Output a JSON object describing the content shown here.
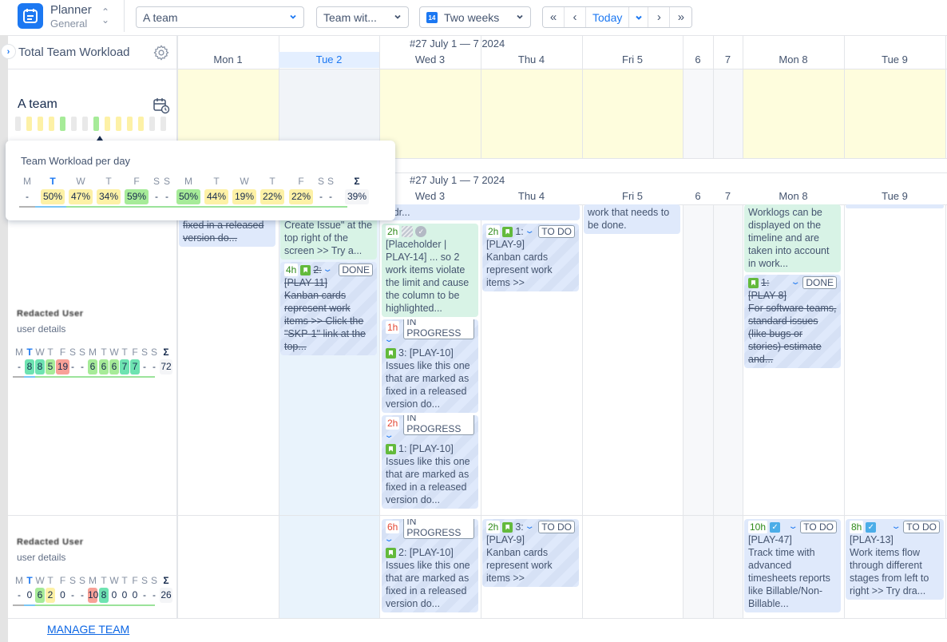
{
  "app": {
    "name": "Planner",
    "subtitle": "General"
  },
  "toolbar": {
    "team_select": "A team",
    "team_with_select": "Team wit...",
    "range_icon_day": "14",
    "range_select": "Two weeks",
    "nav_first": "«",
    "nav_prev": "‹",
    "today": "Today",
    "nav_next": "›",
    "nav_last": "»"
  },
  "panel": {
    "title": "Total Team Workload",
    "manage_team": "MANAGE TEAM"
  },
  "calendar": {
    "week_label": "#27 July 1 — 7 2024",
    "days": [
      "Mon 1",
      "Tue 2",
      "Wed 3",
      "Thu 4",
      "Fri 5",
      "6",
      "7",
      "Mon 8",
      "Tue 9"
    ],
    "today_index": 1
  },
  "team": {
    "name": "A team",
    "minibar_levels": [
      "none",
      "low",
      "low",
      "low",
      "mid",
      "none",
      "none",
      "mid",
      "low",
      "low",
      "low",
      "low",
      "none",
      "none"
    ]
  },
  "tooltip": {
    "title": "Team Workload per day",
    "headers": [
      "M",
      "T",
      "W",
      "T",
      "F",
      "S",
      "S",
      "M",
      "T",
      "W",
      "T",
      "F",
      "S",
      "S",
      "Σ"
    ],
    "values": [
      "-",
      "50%",
      "47%",
      "34%",
      "59%",
      "-",
      "-",
      "50%",
      "44%",
      "19%",
      "22%",
      "22%",
      "-",
      "-",
      "39%"
    ],
    "levels": [
      "none",
      "low",
      "low",
      "low",
      "mid",
      "none",
      "none",
      "mid",
      "low",
      "low",
      "low",
      "low",
      "none",
      "none",
      "sum"
    ]
  },
  "users": [
    {
      "name": "Redacted User",
      "details_label": "user details",
      "headers": [
        "M",
        "T",
        "W",
        "T",
        "F",
        "S",
        "S",
        "M",
        "T",
        "W",
        "T",
        "F",
        "S",
        "S",
        "Σ"
      ],
      "values": [
        "-",
        "8",
        "8",
        "5",
        "19",
        "-",
        "-",
        "6",
        "6",
        "6",
        "7",
        "7",
        "-",
        "-",
        "72"
      ],
      "levels": [
        "none",
        "ok",
        "ok",
        "mid",
        "over",
        "none",
        "none",
        "mid",
        "mid",
        "mid",
        "ok",
        "ok",
        "none",
        "none",
        "sum"
      ]
    },
    {
      "name": "Redacted User",
      "details_label": "user details",
      "headers": [
        "M",
        "T",
        "W",
        "T",
        "F",
        "S",
        "S",
        "M",
        "T",
        "W",
        "T",
        "F",
        "S",
        "S",
        "Σ"
      ],
      "values": [
        "-",
        "0",
        "6",
        "2",
        "0",
        "-",
        "-",
        "10",
        "8",
        "0",
        "0",
        "0",
        "-",
        "-",
        "26"
      ],
      "levels": [
        "none",
        "none",
        "mid",
        "low",
        "none",
        "none",
        "none",
        "over",
        "ok",
        "none",
        "none",
        "none",
        "none",
        "none",
        "sum"
      ]
    }
  ],
  "cards": {
    "u1_mon1": {
      "text": "fixed in a released version do..."
    },
    "u1_tue2_a": {
      "text": "Create Issue\" at the top right of the screen >> Try a..."
    },
    "u1_tue2_b": {
      "hours": "4h",
      "num": "2:",
      "status": "DONE",
      "key": "[PLAY-11]",
      "text": "Kanban cards represent work items >> Click the \"SKP-1\" link at the top..."
    },
    "u1_wedthu_top": {
      "text": "y dr..."
    },
    "u1_wed3_a": {
      "hours": "2h",
      "text": "[Placeholder | PLAY-14] ... so 2 work items violate the limit and cause the column to be highlighted..."
    },
    "u1_wed3_b": {
      "hours": "1h",
      "status": "IN PROGRESS",
      "title": "3: [PLAY-10]",
      "text": "Issues like this one that are marked as fixed in a released version do..."
    },
    "u1_wed3_c": {
      "hours": "2h",
      "status": "IN PROGRESS",
      "title": "1: [PLAY-10]",
      "text": "Issues like this one that are marked as fixed in a released version do..."
    },
    "u1_thu4": {
      "hours": "2h",
      "num": "1:",
      "status": "TO DO",
      "key": "[PLAY-9]",
      "text": "Kanban cards represent work items >>"
    },
    "u1_fri5": {
      "text": "work that needs to be done."
    },
    "u1_mon8_a": {
      "text": "Worklogs can be displayed on the timeline and are taken into account in work..."
    },
    "u1_mon8_b": {
      "num": "1:",
      "status": "DONE",
      "key": "[PLAY-8]",
      "text": "For software teams, standard issues (like bugs or stories) estimate and..."
    },
    "u2_wed3": {
      "hours": "6h",
      "status": "IN PROGRESS",
      "title": "2: [PLAY-10]",
      "text": "Issues like this one that are marked as fixed in a released version do..."
    },
    "u2_thu4": {
      "hours": "2h",
      "num": "3:",
      "status": "TO DO",
      "key": "[PLAY-9]",
      "text": "Kanban cards represent work items >>"
    },
    "u2_mon8": {
      "hours": "10h",
      "status": "TO DO",
      "key": "[PLAY-47]",
      "text": "Track time with advanced timesheets reports like Billable/Non-Billable..."
    },
    "u2_tue9": {
      "hours": "8h",
      "status": "TO DO",
      "key": "[PLAY-13]",
      "text": "Work items flow through different stages from left to right >> Try dra..."
    }
  },
  "colors": {
    "accent": "#1c78f2",
    "level_none": "#e9e9e9",
    "level_low": "#fdf1a6",
    "level_mid": "#a6eb98",
    "level_ok": "#6ee3b1",
    "level_over": "#f8a197",
    "level_sum": "#f4f5f7"
  }
}
